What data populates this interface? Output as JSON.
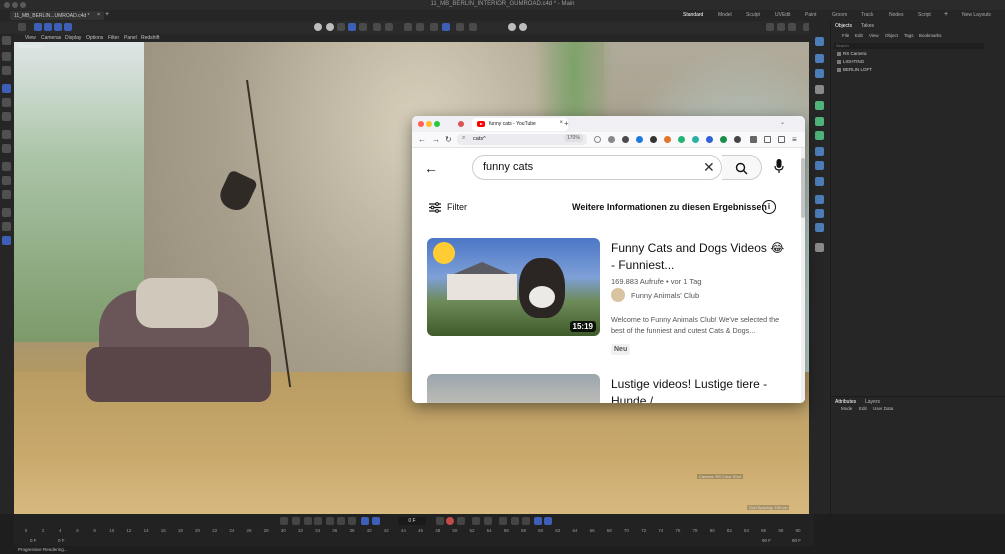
{
  "window": {
    "title": "11_MB_BERLIN_INTERIOR_GUMROAD.c4d * - Main",
    "doc_tab": "11_MB_BERLIN...UMROAD.c4d *",
    "doc_tab_close": "×"
  },
  "layouts": [
    "Standard",
    "Model",
    "Sculpt",
    "UVEdit",
    "Paint",
    "Groom",
    "Track",
    "Nodes",
    "Script"
  ],
  "layouts_active": "Standard",
  "new_layouts": "New Layouts",
  "viewport_menu": [
    "View",
    "Cameras",
    "Display",
    "Options",
    "Filter",
    "Panel",
    "Redshift"
  ],
  "viewport_overlay": "Perspective",
  "viewport_camera_label": "Camera: RS Color Shot",
  "viewport_grid_label": "Grid Spacing: 100 cm",
  "object_panel": {
    "tabs": [
      "Objects",
      "Takes"
    ],
    "menu": [
      "File",
      "Edit",
      "View",
      "Object",
      "Tags",
      "Bookmarks"
    ],
    "search_placeholder": "Search",
    "objects": [
      "RS Camera",
      "LIGHTING",
      "BERLIN LOFT"
    ]
  },
  "attributes_panel": {
    "tabs": [
      "Attributes",
      "Layers"
    ],
    "menu": [
      "Mode",
      "Edit",
      "User Data"
    ]
  },
  "timeline": {
    "current_frame": "0 F",
    "start_field": "0 F",
    "start_field2": "0 F",
    "end_field": "90 F",
    "end_field2": "90 F",
    "ticks": [
      "0",
      "2",
      "4",
      "6",
      "8",
      "10",
      "12",
      "14",
      "16",
      "18",
      "20",
      "22",
      "24",
      "26",
      "28",
      "30",
      "32",
      "34",
      "36",
      "38",
      "40",
      "42",
      "44",
      "46",
      "48",
      "50",
      "52",
      "54",
      "56",
      "58",
      "60",
      "62",
      "64",
      "66",
      "68",
      "70",
      "72",
      "74",
      "76",
      "78",
      "80",
      "82",
      "84",
      "86",
      "88",
      "90"
    ]
  },
  "status": "Progressive Rendering...",
  "browser": {
    "tab_title": "funny cats - YouTube",
    "tab_close": "×",
    "new_tab": "+",
    "url": "cats^",
    "zoom": "170%",
    "extension_colors": [
      "#888888",
      "#4a4a4a",
      "#1f7ae0",
      "#333333",
      "#e2742b",
      "#22b573",
      "#2bb0a5",
      "#2e62d6",
      "#1a8f4a",
      "#444444"
    ],
    "accent": "#ff0000"
  },
  "youtube": {
    "query": "funny cats",
    "filter_label": "Filter",
    "info_label": "Weitere Informationen zu diesen Ergebnissen",
    "results": [
      {
        "title": "Funny Cats and Dogs Videos 😂 - Funniest...",
        "meta": "169.883 Aufrufe • vor 1 Tag",
        "channel": "Funny Animals' Club",
        "description": "Welcome to Funny Animals Club! We've selected the best of the funniest and cutest Cats & Dogs...",
        "duration": "15:19",
        "badge": "Neu"
      },
      {
        "title": "Lustige videos! Lustige tiere - Hunde / ..."
      }
    ]
  }
}
